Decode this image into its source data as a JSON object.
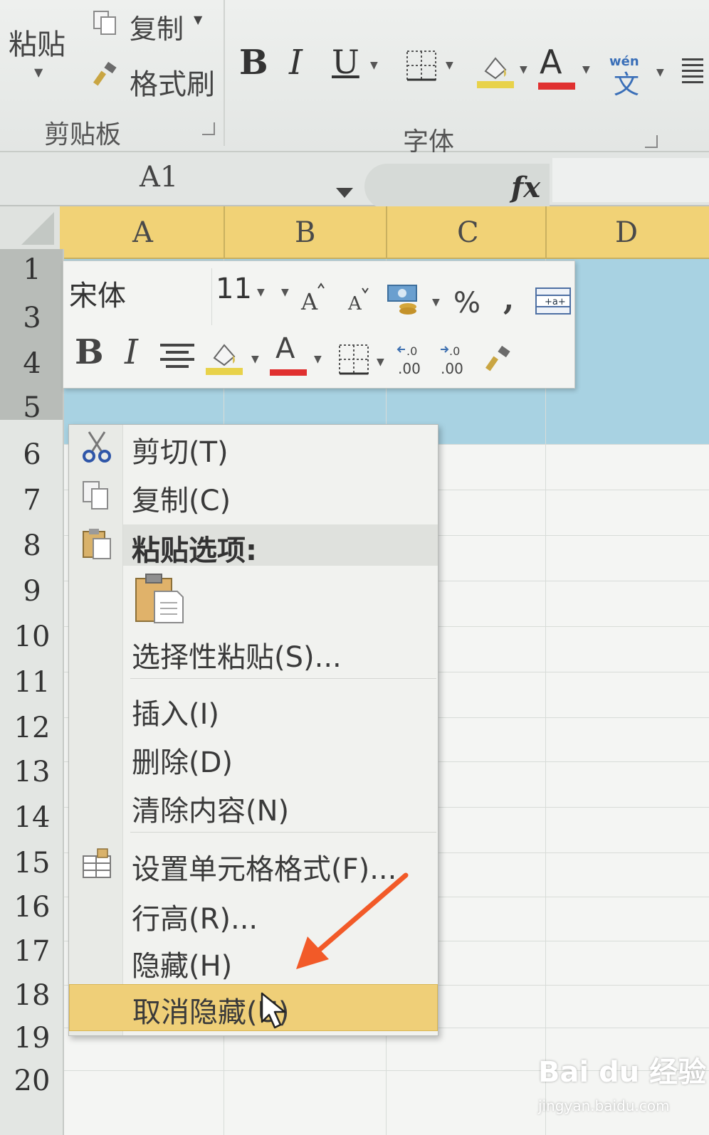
{
  "ribbon": {
    "clipboard": {
      "paste_label": "粘贴",
      "copy_label": "复制",
      "format_painter_label": "格式刷",
      "group_label": "剪贴板"
    },
    "font_group": {
      "group_label": "字体",
      "bold": "B",
      "italic": "I",
      "underline": "U",
      "font_color": "A",
      "phonetic_top": "wén",
      "phonetic_char": "文"
    }
  },
  "formula_bar": {
    "name_box": "A1",
    "fx": "fx"
  },
  "sheet": {
    "columns": [
      "A",
      "B",
      "C",
      "D"
    ],
    "rows": [
      "1",
      "3",
      "4",
      "5",
      "6",
      "7",
      "8",
      "9",
      "10",
      "11",
      "12",
      "13",
      "14",
      "15",
      "16",
      "17",
      "18",
      "19",
      "20"
    ]
  },
  "mini_toolbar": {
    "font_name": "宋体",
    "font_size": "11",
    "bold": "B",
    "italic": "I",
    "font_color": "A",
    "percent": "%",
    "comma": ","
  },
  "context_menu": {
    "cut": "剪切(T)",
    "copy": "复制(C)",
    "paste_options": "粘贴选项:",
    "paste_special": "选择性粘贴(S)...",
    "insert": "插入(I)",
    "delete": "删除(D)",
    "clear_contents": "清除内容(N)",
    "format_cells": "设置单元格格式(F)...",
    "row_height": "行高(R)...",
    "hide": "隐藏(H)",
    "unhide": "取消隐藏(U)"
  },
  "watermark": {
    "brand": "Bai du 经验",
    "url": "jingyan.baidu.com"
  },
  "colors": {
    "header_selected": "#f1d276",
    "selection": "#a8d2e2",
    "menu_highlight": "#efcf78",
    "annotation_arrow": "#f25a28"
  }
}
